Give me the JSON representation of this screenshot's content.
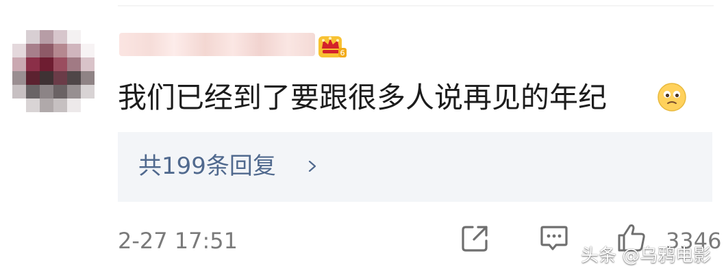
{
  "comment": {
    "text": "我们已经到了要跟很多人说再见的年纪",
    "emoji": "sad-face-emoji",
    "badge": "crown-level-badge"
  },
  "replies": {
    "label": "共199条回复",
    "icon": "chevron-right-icon"
  },
  "footer": {
    "timestamp": "2-27 17:51",
    "actions": {
      "share_icon": "share-icon",
      "comment_icon": "comment-icon",
      "like_icon": "thumbs-up-icon"
    },
    "like_count": "3346"
  },
  "watermark": "头条 @乌鸦电影",
  "colors": {
    "reply_link": "#50698e",
    "reply_background": "#f3f5f8",
    "meta_text": "#7a7a7a"
  }
}
